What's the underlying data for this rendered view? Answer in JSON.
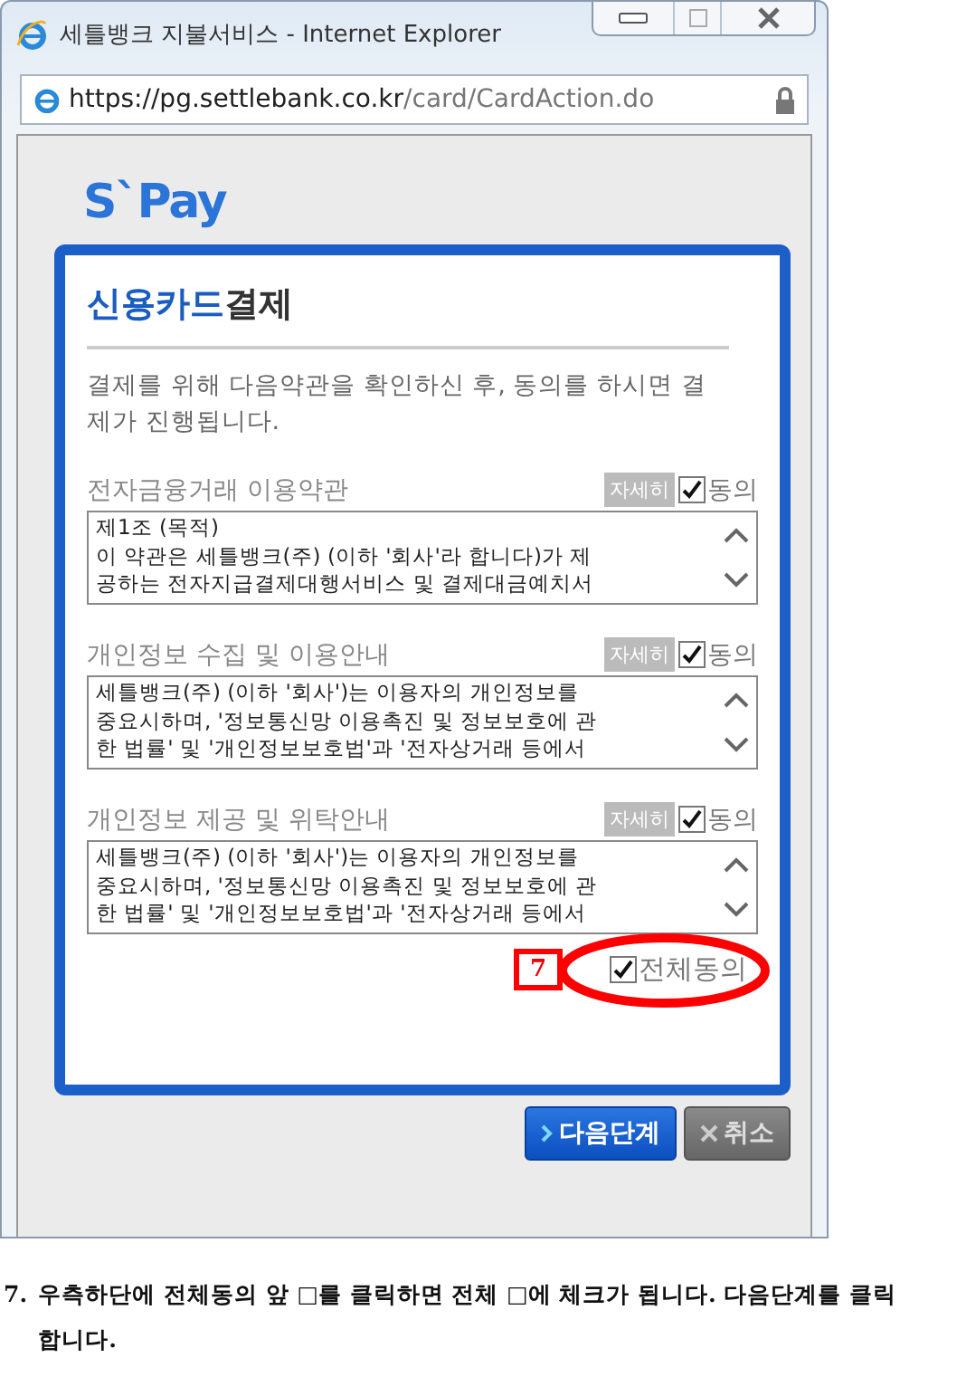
{
  "window": {
    "title": "세틀뱅크 지불서비스 - Internet Explorer",
    "address": {
      "host": "https://pg.settlebank.co.kr",
      "path": "/card/CardAction.do"
    }
  },
  "logo": {
    "text": "S`Pay"
  },
  "card": {
    "title": [
      {
        "text": "신용카드",
        "kind": "accent"
      },
      {
        "text": "결제",
        "kind": "plain"
      }
    ],
    "intro": "결제를 위해 다음약관을 확인하신 후, 동의를 하시면 결제가 진행됩니다.",
    "terms": [
      {
        "label": "전자금융거래 이용약관",
        "detail_button": "자세히",
        "agree_label": "동의",
        "checked": true,
        "text": "제1조 (목적)\n이 약관은 세틀뱅크(주) (이하 '회사'라 합니다)가 제\n공하는 전자지급결제대행서비스 및 결제대금예치서"
      },
      {
        "label": "개인정보 수집 및 이용안내",
        "detail_button": "자세히",
        "agree_label": "동의",
        "checked": true,
        "text": "세틀뱅크(주) (이하 '회사')는 이용자의 개인정보를\n중요시하며, '정보통신망 이용촉진 및 정보보호에 관\n한 법률' 및 '개인정보보호법'과 '전자상거래 등에서"
      },
      {
        "label": "개인정보 제공 및 위탁안내",
        "detail_button": "자세히",
        "agree_label": "동의",
        "checked": true,
        "text": "세틀뱅크(주) (이하 '회사')는 이용자의 개인정보를\n중요시하며, '정보통신망 이용촉진 및 정보보호에 관\n한 법률' 및 '개인정보보호법'과 '전자상거래 등에서"
      }
    ],
    "agree_all": {
      "label": "전체동의",
      "checked": true
    },
    "annotation": {
      "label": "7"
    }
  },
  "buttons": [
    {
      "label": "다음단계",
      "kind": "primary"
    },
    {
      "label": "취소",
      "kind": "cancel"
    }
  ],
  "caption": {
    "number": "7.",
    "text": "우측하단에 전체동의 앞 □를 클릭하면 전체 □에 체크가 됩니다. 다음단계를 클릭합니다."
  }
}
